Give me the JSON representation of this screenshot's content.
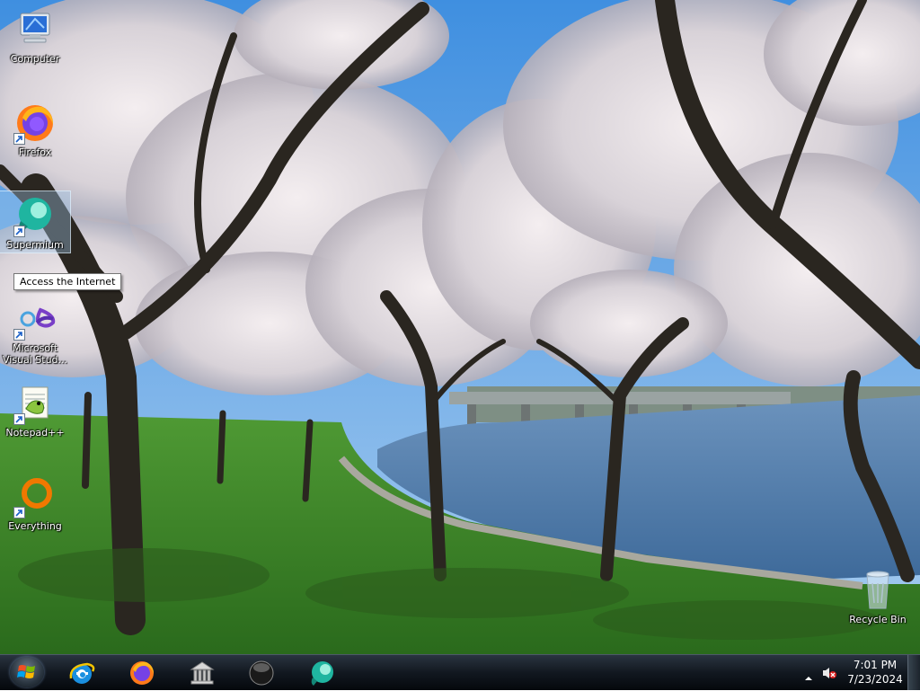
{
  "desktop": {
    "icons": [
      {
        "label": "Computer",
        "icon": "computer-icon"
      },
      {
        "label": "Firefox",
        "icon": "firefox-icon"
      },
      {
        "label": "Supermium",
        "icon": "supermium-icon"
      },
      {
        "label": "Microsoft Visual Stud...",
        "icon": "visual-studio-icon"
      },
      {
        "label": "Notepad++",
        "icon": "notepadpp-icon"
      },
      {
        "label": "Everything",
        "icon": "everything-icon"
      },
      {
        "label": "Recycle Bin",
        "icon": "recycle-bin-icon"
      }
    ],
    "tooltip": "Access the Internet"
  },
  "taskbar": {
    "start": "start-orb-icon",
    "pinned": [
      {
        "app": "Internet Explorer",
        "icon": "internet-explorer-icon"
      },
      {
        "app": "Firefox",
        "icon": "firefox-icon"
      },
      {
        "app": "Library",
        "icon": "library-icon"
      },
      {
        "app": "App",
        "icon": "dark-sphere-icon"
      },
      {
        "app": "Supermium",
        "icon": "supermium-icon"
      }
    ],
    "tray": {
      "volume": "volume-muted-icon",
      "time": "7:01 PM",
      "date": "7/23/2024"
    }
  },
  "colors": {
    "taskbar": "#121820",
    "sky": "#5ea3e4",
    "grass": "#3f8a2a",
    "water": "#4f7fb0"
  }
}
